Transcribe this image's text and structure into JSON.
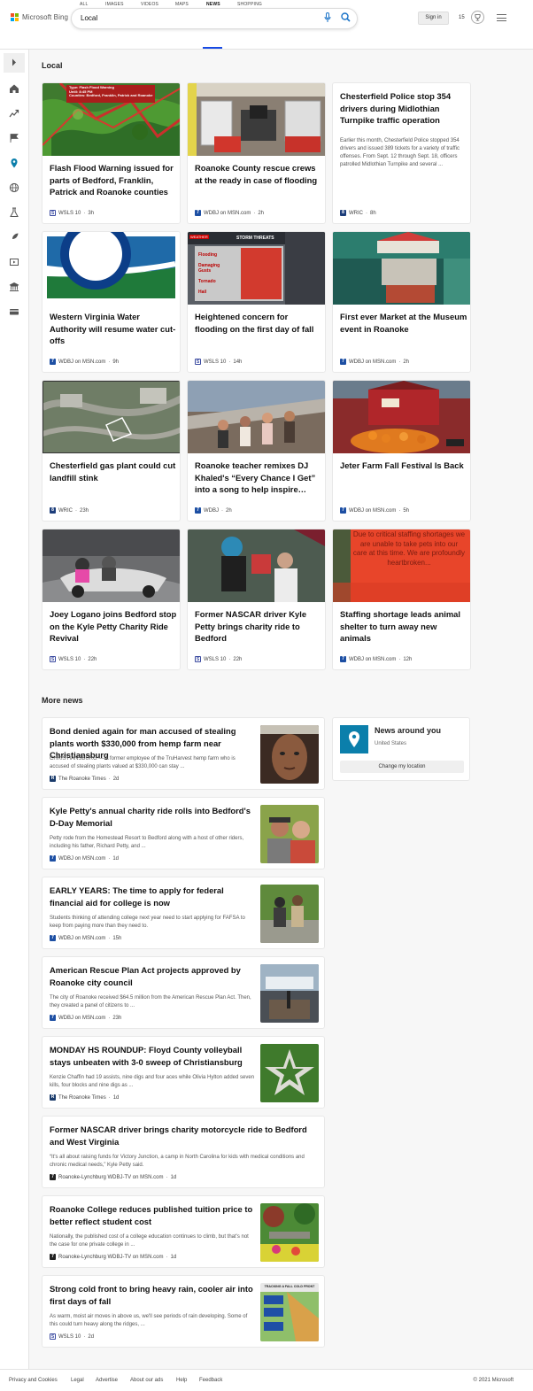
{
  "brand": {
    "logo_text": "Microsoft Bing",
    "logo_colors": [
      "#f25022",
      "#7fba00",
      "#00a4ef",
      "#ffb900"
    ]
  },
  "search": {
    "query": "Local"
  },
  "header": {
    "signin_label": "Sign in",
    "rewards_count": "15"
  },
  "tabs": [
    "ALL",
    "IMAGES",
    "VIDEOS",
    "MAPS",
    "NEWS",
    "SHOPPING"
  ],
  "active_tab": "NEWS",
  "accent_color": "#174ae4",
  "sidebar": [
    "expand-icon",
    "home-icon",
    "trending-icon",
    "flag-icon",
    "location-icon",
    "globe-icon",
    "science-icon",
    "rocket-icon",
    "video-icon",
    "government-icon",
    "finance-icon"
  ],
  "local": {
    "title": "Local",
    "cards": [
      {
        "title": "Flash Flood Warning issued for parts of Bedford, Franklin, Patrick and Roanoke counties",
        "source": "WSLS 10",
        "time": "3h",
        "image_caption": "Type: Flash Flood Warning\nUntil: 8:45 PM\nCounties: Bedford, Franklin, Patrick and Roanoke"
      },
      {
        "title": "Roanoke County rescue crews at the ready in case of flooding",
        "source": "WDBJ on MSN.com",
        "time": "2h"
      },
      {
        "title": "Chesterfield Police stop 354 drivers during Midlothian Turnpike traffic operation",
        "source": "WRIC",
        "time": "8h",
        "snippet": "Earlier this month, Chesterfield Police stopped 354 drivers and issued 389 tickets for a variety of traffic offenses. From Sept. 12 through Sept. 18, officers patrolled Midlothian Turnpike and several ..."
      },
      {
        "title": "Western Virginia Water Authority will resume water cut-offs",
        "source": "WDBJ on MSN.com",
        "time": "9h"
      },
      {
        "title": "Heightened concern for flooding on the first day of fall",
        "source": "WSLS 10",
        "time": "14h",
        "image_caption": "STORM THREATS",
        "image_rows": [
          "Flooding",
          "Damaging Gusts",
          "Tornado",
          "Hail"
        ],
        "image_tag": "WEATHER"
      },
      {
        "title": "First ever Market at the Museum event in Roanoke",
        "source": "WDBJ on MSN.com",
        "time": "2h"
      },
      {
        "title": "Chesterfield gas plant could cut landfill stink",
        "source": "WRIC",
        "time": "23h"
      },
      {
        "title": "Roanoke teacher remixes DJ Khaled's “Every Chance I Get” into a song to help inspire…",
        "source": "WDBJ",
        "time": "2h"
      },
      {
        "title": "Jeter Farm Fall Festival Is Back",
        "source": "WDBJ on MSN.com",
        "time": "5h"
      },
      {
        "title": "Joey Logano joins Bedford stop on the Kyle Petty Charity Ride Revival",
        "source": "WSLS 10",
        "time": "22h"
      },
      {
        "title": "Former NASCAR driver Kyle Petty brings charity ride to Bedford",
        "source": "WSLS 10",
        "time": "22h"
      },
      {
        "title": "Staffing shortage leads animal shelter to turn away new animals",
        "source": "WDBJ on MSN.com",
        "time": "12h",
        "image_caption": "Due to critical staffing shortages we are unable to take pets into our care at this time. We are profoundly heartbroken..."
      }
    ]
  },
  "more_news": {
    "title": "More news",
    "items": [
      {
        "title": "Bond denied again for man accused of stealing plants worth $330,000 from hemp farm near Christiansburg",
        "snippet": "CHRISTIANSBURG — A former employee of the TruHarvest hemp farm who is accused of stealing plants valued at $330,000 can stay ...",
        "source": "The Roanoke Times",
        "time": "2d"
      },
      {
        "title": "Kyle Petty's annual charity ride rolls into Bedford's D-Day Memorial",
        "snippet": "Petty rode from the Homestead Resort to Bedford along with a host of other riders, including his father, Richard Petty, and ...",
        "source": "WDBJ on MSN.com",
        "time": "1d"
      },
      {
        "title": "EARLY YEARS: The time to apply for federal financial aid for college is now",
        "snippet": "Students thinking of attending college next year need to start applying for FAFSA to keep from paying more than they need to.",
        "source": "WDBJ on MSN.com",
        "time": "15h"
      },
      {
        "title": "American Rescue Plan Act projects approved by Roanoke city council",
        "snippet": "The city of Roanoke received $64.5 million from the American Rescue Plan Act. Then, they created a panel of citizens to ...",
        "source": "WDBJ on MSN.com",
        "time": "23h"
      },
      {
        "title": "MONDAY HS ROUNDUP: Floyd County volleyball stays unbeaten with 3-0 sweep of Christiansburg",
        "snippet": "Kenzie Chaffin had 19 assists, nine digs and four aces while Olivia Hylton added seven kills, four blocks and nine digs as ...",
        "source": "The Roanoke Times",
        "time": "1d"
      },
      {
        "title": "Former NASCAR driver brings charity motorcycle ride to Bedford and West Virginia",
        "snippet": "“It's all about raising funds for Victory Junction, a camp in North Carolina for kids with medical conditions and chronic medical needs,” Kyle Petty said.",
        "source": "Roanoke-Lynchburg WDBJ-TV on MSN.com",
        "time": "1d"
      },
      {
        "title": "Roanoke College reduces published tuition price to better reflect student cost",
        "snippet": "Nationally, the published cost of a college education continues to climb, but that's not the case for one private college in ...",
        "source": "Roanoke-Lynchburg WDBJ-TV on MSN.com",
        "time": "1d"
      },
      {
        "title": "Strong cold front to bring heavy rain, cooler air into first days of fall",
        "snippet": "As warm, moist air moves in above us, we'll see periods of rain developing. Some of this could turn heavy along the ridges, ...",
        "source": "WSLS 10",
        "time": "2d",
        "image_caption": "TRACKING A FALL COLD FRONT"
      }
    ]
  },
  "around": {
    "title": "News around you",
    "location": "United States",
    "button": "Change my location"
  },
  "footer": {
    "links": [
      "Privacy and Cookies",
      "Legal",
      "Advertise",
      "About our ads",
      "Help",
      "Feedback"
    ],
    "copyright": "© 2021 Microsoft"
  }
}
